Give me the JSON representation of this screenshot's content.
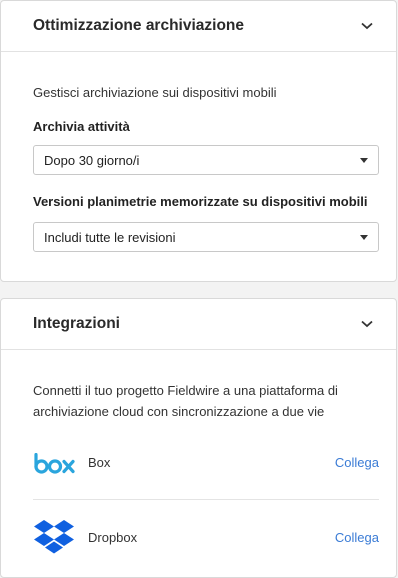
{
  "storage": {
    "title": "Ottimizzazione archiviazione",
    "description": "Gestisci archiviazione sui dispositivi mobili",
    "activity_label": "Archivia attività",
    "activity_value": "Dopo 30 giorno/i",
    "plans_label": "Versioni planimetrie memorizzate su dispositivi mobili",
    "plans_value": "Includi tutte le revisioni"
  },
  "integrations": {
    "title": "Integrazioni",
    "description_line1": "Connetti il tuo progetto Fieldwire a una piattaforma di",
    "description_line2": "archiviazione cloud con sincronizzazione a due vie",
    "items": [
      {
        "logo": "box",
        "name": "Box",
        "action": "Collega",
        "color": "#2aa5dd"
      },
      {
        "logo": "dropbox",
        "name": "Dropbox",
        "action": "Collega",
        "color": "#1060e0"
      }
    ]
  }
}
